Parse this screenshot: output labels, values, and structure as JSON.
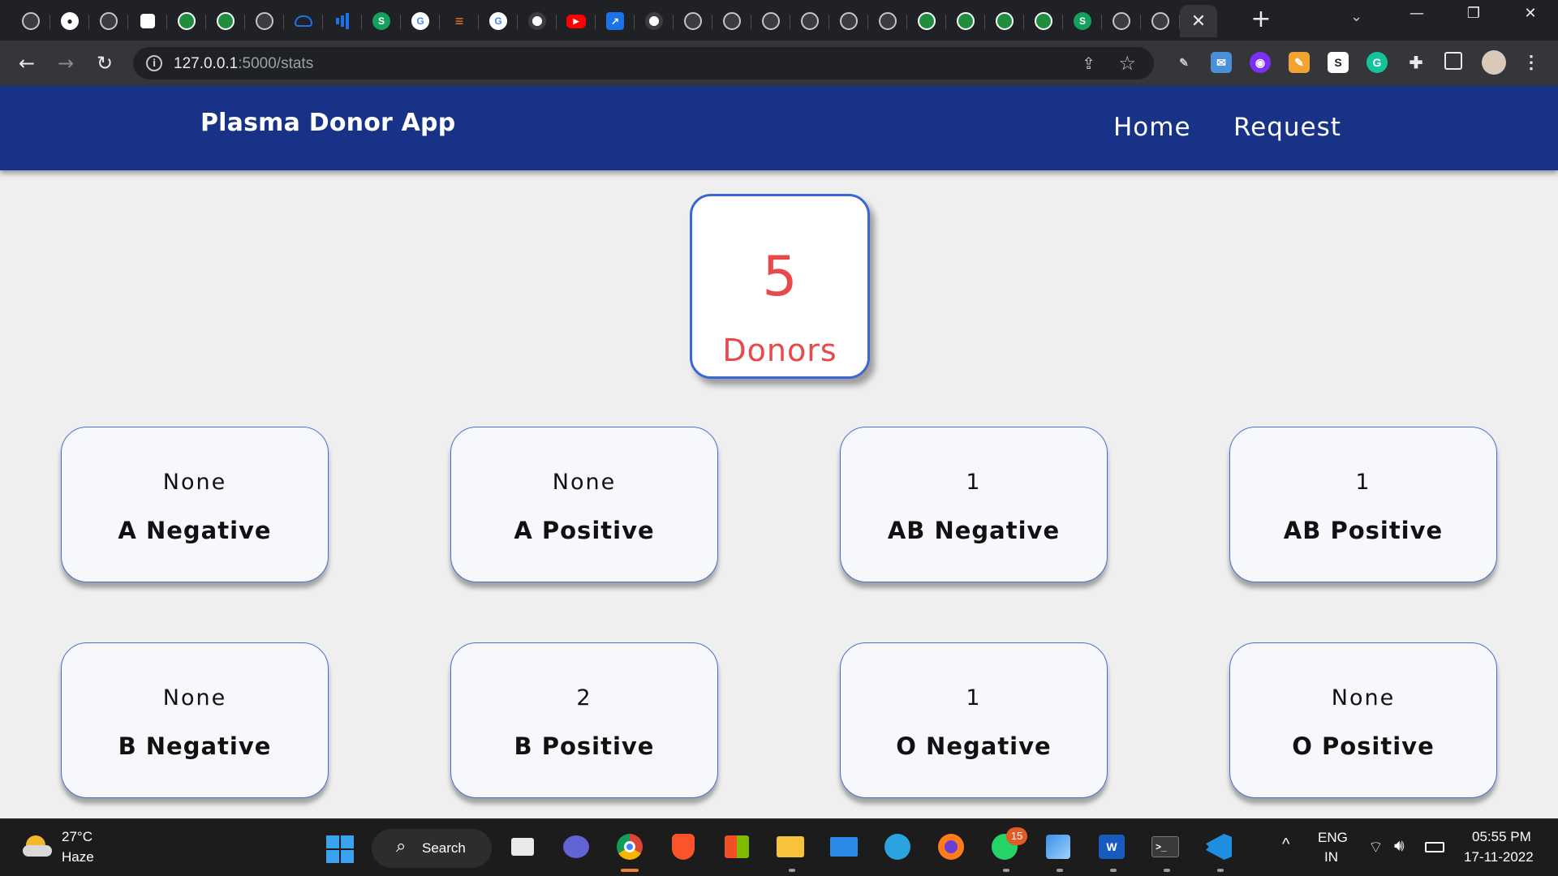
{
  "browser": {
    "tabs": [
      {
        "icon": "globe-icon"
      },
      {
        "icon": "github-icon"
      },
      {
        "icon": "globe-icon"
      },
      {
        "icon": "cube-icon"
      },
      {
        "icon": "leaf-icon"
      },
      {
        "icon": "leaf-icon"
      },
      {
        "icon": "globe-icon"
      },
      {
        "icon": "cloud-icon"
      },
      {
        "icon": "bar-chart-icon"
      },
      {
        "icon": "s-icon",
        "glyph": "S"
      },
      {
        "icon": "google-icon",
        "glyph": "G"
      },
      {
        "icon": "stackoverflow-icon"
      },
      {
        "icon": "google-icon",
        "glyph": "G"
      },
      {
        "icon": "chrome-icon"
      },
      {
        "icon": "youtube-icon"
      },
      {
        "icon": "share-icon"
      },
      {
        "icon": "chrome-icon"
      },
      {
        "icon": "globe-icon"
      },
      {
        "icon": "globe-icon"
      },
      {
        "icon": "globe-icon"
      },
      {
        "icon": "globe-icon"
      },
      {
        "icon": "globe-icon"
      },
      {
        "icon": "globe-icon"
      },
      {
        "icon": "leaf-icon"
      },
      {
        "icon": "leaf-icon"
      },
      {
        "icon": "leaf-icon"
      },
      {
        "icon": "leaf-icon"
      },
      {
        "icon": "s-icon",
        "glyph": "S"
      },
      {
        "icon": "globe-icon"
      },
      {
        "icon": "globe-icon"
      }
    ],
    "url_host": "127.0.0.1",
    "url_rest": ":5000/stats"
  },
  "app": {
    "brand": "Plasma Donor App",
    "nav": {
      "home": "Home",
      "request": "Request"
    },
    "total": {
      "count": "5",
      "label": "Donors"
    },
    "blood_groups": [
      {
        "count": "None",
        "name": "A Negative"
      },
      {
        "count": "None",
        "name": "A Positive"
      },
      {
        "count": "1",
        "name": "AB Negative"
      },
      {
        "count": "1",
        "name": "AB Positive"
      },
      {
        "count": "None",
        "name": "B Negative"
      },
      {
        "count": "2",
        "name": "B Positive"
      },
      {
        "count": "1",
        "name": "O Negative"
      },
      {
        "count": "None",
        "name": "O Positive"
      }
    ],
    "colors": {
      "header": "#173287",
      "accent": "#e8494b",
      "card_border": "#4b6fd6"
    }
  },
  "taskbar": {
    "weather_temp": "27°C",
    "weather_desc": "Haze",
    "search_label": "Search",
    "whatsapp_badge": "15",
    "lang_top": "ENG",
    "lang_bottom": "IN",
    "time": "05:55 PM",
    "date": "17-11-2022"
  }
}
